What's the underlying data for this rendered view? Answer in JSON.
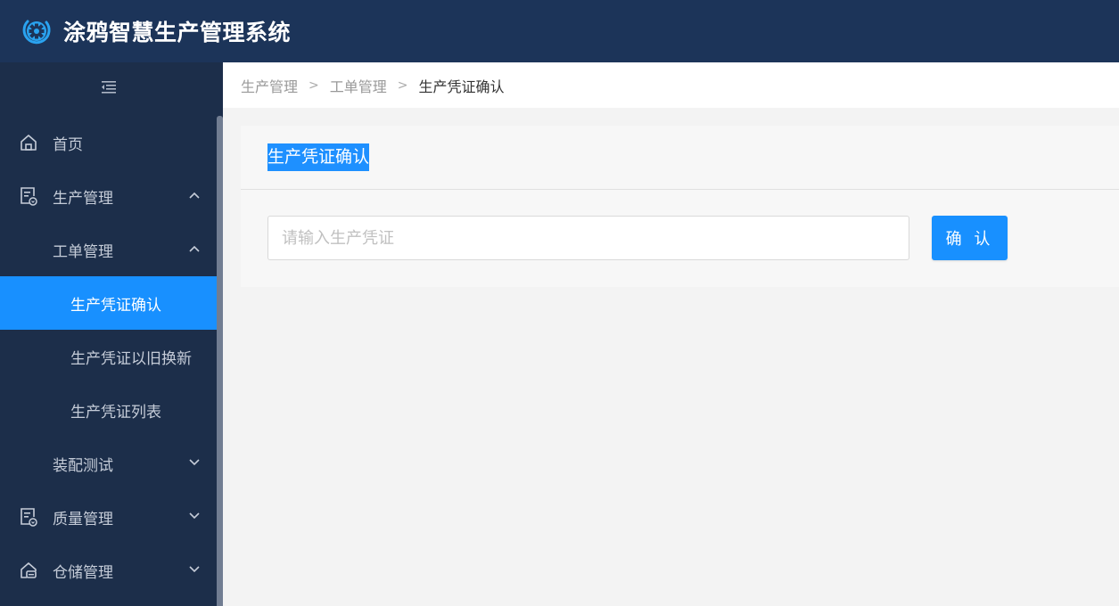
{
  "header": {
    "app_title": "涂鸦智慧生产管理系统",
    "logo_icon": "gear-globe-icon",
    "colors": {
      "header_bg": "#1c3459",
      "logo_accent": "#2aa3f0"
    }
  },
  "sidebar": {
    "collapse_icon": "menu-fold-icon",
    "items": [
      {
        "label": "首页",
        "icon": "home-icon",
        "level": 1
      },
      {
        "label": "生产管理",
        "icon": "document-check-icon",
        "level": 1,
        "expanded": true
      },
      {
        "label": "工单管理",
        "level": 2,
        "expanded": true
      },
      {
        "label": "生产凭证确认",
        "level": 3,
        "active": true
      },
      {
        "label": "生产凭证以旧换新",
        "level": 3
      },
      {
        "label": "生产凭证列表",
        "level": 3
      },
      {
        "label": "装配测试",
        "level": 2,
        "expanded": false
      },
      {
        "label": "质量管理",
        "icon": "document-check-icon",
        "level": 1,
        "expanded": false
      },
      {
        "label": "仓储管理",
        "icon": "warehouse-icon",
        "level": 1,
        "expanded": false
      }
    ],
    "colors": {
      "bg": "#1c2e4a",
      "active": "#1890ff",
      "text": "#c5ccd8"
    }
  },
  "breadcrumb": {
    "items": [
      "生产管理",
      "工单管理",
      "生产凭证确认"
    ],
    "separator": ">"
  },
  "card": {
    "title": "生产凭证确认",
    "input": {
      "value": "",
      "placeholder": "请输入生产凭证"
    },
    "confirm_label": "确 认"
  }
}
